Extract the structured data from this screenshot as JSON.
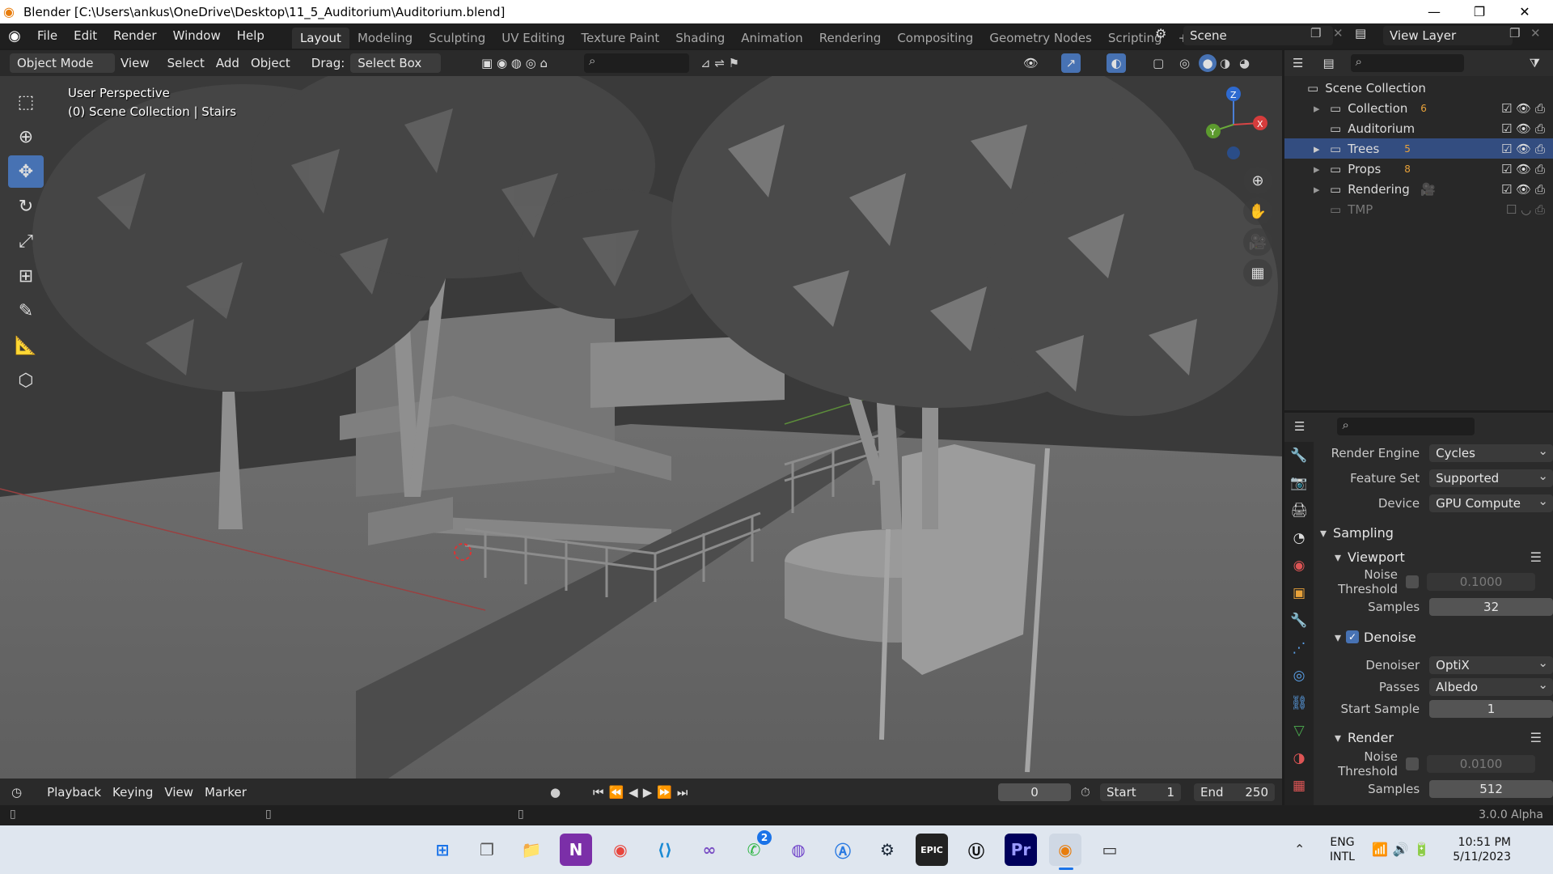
{
  "window": {
    "title": "Blender [C:\\Users\\ankus\\OneDrive\\Desktop\\11_5_Auditorium\\Auditorium.blend]",
    "minimize": "—",
    "maximize": "❐",
    "close": "✕"
  },
  "menus": [
    "File",
    "Edit",
    "Render",
    "Window",
    "Help"
  ],
  "workspaces": [
    "Layout",
    "Modeling",
    "Sculpting",
    "UV Editing",
    "Texture Paint",
    "Shading",
    "Animation",
    "Rendering",
    "Compositing",
    "Geometry Nodes",
    "Scripting"
  ],
  "add_workspace": "+",
  "scene": {
    "label": "Scene",
    "view_layer": "View Layer"
  },
  "header": {
    "mode": "Object Mode",
    "view": "View",
    "select": "Select",
    "add": "Add",
    "object": "Object",
    "drag_label": "Drag:",
    "drag_value": "Select Box"
  },
  "viewport": {
    "perspective": "User Perspective",
    "context": "(0) Scene Collection | Stairs"
  },
  "gizmo": {
    "z": "Z",
    "y": "Y",
    "x": "X"
  },
  "outliner": {
    "root": "Scene Collection",
    "items": [
      {
        "label": "Collection",
        "badge": "6",
        "expander": "▸"
      },
      {
        "label": "Auditorium",
        "badge": "",
        "expander": ""
      },
      {
        "label": "Trees",
        "badge": "5",
        "expander": "▸"
      },
      {
        "label": "Props",
        "badge": "8",
        "expander": "▸"
      },
      {
        "label": "Rendering",
        "badge": "",
        "expander": "▸"
      },
      {
        "label": "TMP",
        "badge": "",
        "expander": ""
      }
    ]
  },
  "properties": {
    "render_engine_label": "Render Engine",
    "render_engine": "Cycles",
    "feature_set_label": "Feature Set",
    "feature_set": "Supported",
    "device_label": "Device",
    "device": "GPU Compute",
    "sampling": "Sampling",
    "viewport": "Viewport",
    "noise_threshold_label": "Noise Threshold",
    "viewport_noise": "0.1000",
    "samples_label": "Samples",
    "viewport_samples": "32",
    "denoise": "Denoise",
    "denoiser_label": "Denoiser",
    "denoiser": "OptiX",
    "passes_label": "Passes",
    "passes": "Albedo",
    "start_sample_label": "Start Sample",
    "start_sample": "1",
    "render": "Render",
    "render_noise": "0.0100",
    "render_samples": "512"
  },
  "timeline": {
    "playback": "Playback",
    "keying": "Keying",
    "view": "View",
    "marker": "Marker",
    "current_frame": "0",
    "start_label": "Start",
    "start": "1",
    "end_label": "End",
    "end": "250"
  },
  "status": {
    "version": "3.0.0 Alpha"
  },
  "taskbar": {
    "lang1": "ENG",
    "lang2": "INTL",
    "time": "10:51 PM",
    "date": "5/11/2023",
    "whatsapp_badge": "2"
  }
}
